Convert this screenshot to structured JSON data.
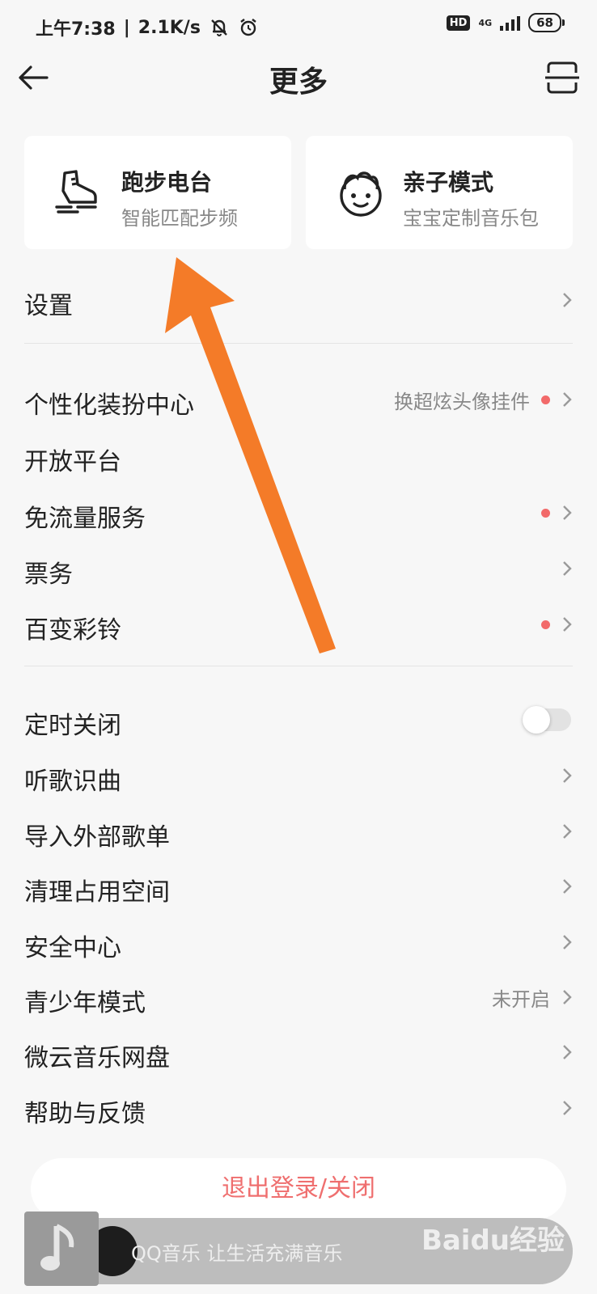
{
  "status_bar": {
    "time": "上午7:38",
    "speed": "2.1K/s",
    "hd_badge": "HD",
    "network": "4G",
    "battery": "68"
  },
  "header": {
    "title": "更多"
  },
  "cards": [
    {
      "title": "跑步电台",
      "subtitle": "智能匹配步频",
      "icon": "running-shoe-icon"
    },
    {
      "title": "亲子模式",
      "subtitle": "宝宝定制音乐包",
      "icon": "baby-face-icon"
    }
  ],
  "menu": {
    "settings": "设置",
    "personalize": {
      "label": "个性化装扮中心",
      "hint": "换超炫头像挂件"
    },
    "open_platform": "开放平台",
    "free_data": "免流量服务",
    "tickets": "票务",
    "ringtone": "百变彩铃",
    "sleep_timer": "定时关闭",
    "recognize": "听歌识曲",
    "import_playlist": "导入外部歌单",
    "clean_space": "清理占用空间",
    "security": "安全中心",
    "teen_mode": {
      "label": "青少年模式",
      "hint": "未开启"
    },
    "weiyun": "微云音乐网盘",
    "help": "帮助与反馈"
  },
  "logout_label": "退出登录/关闭",
  "player": {
    "text": "QQ音乐 让生活充满音乐"
  },
  "watermark": "Baidu经验",
  "colors": {
    "accent_red": "#ef6f6f",
    "dot_red": "#f26a6a",
    "arrow_orange": "#f47b28"
  }
}
